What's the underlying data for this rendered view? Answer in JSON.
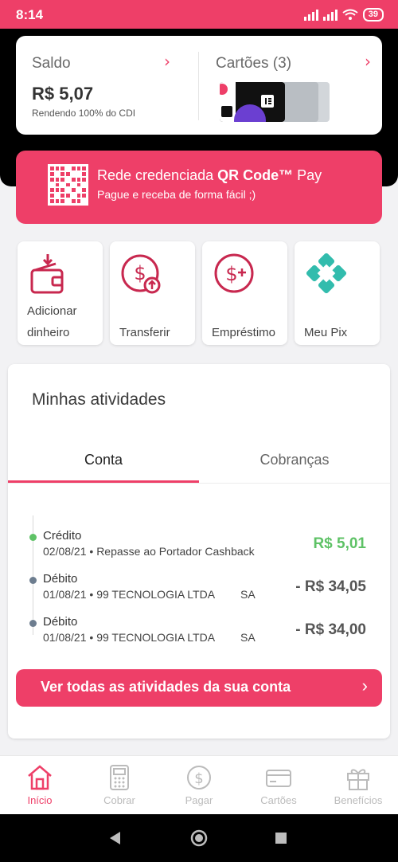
{
  "status_bar": {
    "time": "8:14",
    "battery": "39"
  },
  "balance": {
    "title": "Saldo",
    "value": "R$ 5,07",
    "subtitle": "Rendendo 100% do CDI"
  },
  "cards": {
    "title": "Cartões (3)"
  },
  "qr_banner": {
    "title_prefix": "Rede credenciada ",
    "title_bold": "QR Code™",
    "title_suffix": " Pay",
    "subtitle": "Pague e receba de forma fácil ;)"
  },
  "actions": [
    {
      "label_line1": "Adicionar",
      "label_line2": "dinheiro",
      "icon": "wallet-add-icon"
    },
    {
      "label_line1": "",
      "label_line2": "Transferir",
      "icon": "transfer-money-icon"
    },
    {
      "label_line1": "",
      "label_line2": "Empréstimo",
      "icon": "loan-icon"
    },
    {
      "label_line1": "",
      "label_line2": "Meu Pix",
      "icon": "pix-icon"
    }
  ],
  "activities": {
    "title": "Minhas atividades",
    "tabs": [
      "Conta",
      "Cobranças"
    ],
    "items": [
      {
        "type": "Crédito",
        "date": "02/08/21",
        "description": "Repasse ao Portador Cashback",
        "amount": "R$ 5,01",
        "kind": "credit"
      },
      {
        "type": "Débito",
        "date": "01/08/21",
        "description": "99 TECNOLOGIA LTDA",
        "suffix": "SA",
        "amount": "- R$ 34,05",
        "kind": "debit"
      },
      {
        "type": "Débito",
        "date": "01/08/21",
        "description": "99 TECNOLOGIA LTDA",
        "suffix": "SA",
        "amount": "- R$ 34,00",
        "kind": "debit"
      }
    ],
    "view_all": "Ver todas as atividades da sua conta"
  },
  "bottom_nav": [
    {
      "label": "Início",
      "active": true
    },
    {
      "label": "Cobrar",
      "active": false
    },
    {
      "label": "Pagar",
      "active": false
    },
    {
      "label": "Cartões",
      "active": false
    },
    {
      "label": "Benefícios",
      "active": false
    }
  ],
  "colors": {
    "accent": "#ee3f68",
    "credit": "#5ec266",
    "pix": "#32bcad"
  }
}
